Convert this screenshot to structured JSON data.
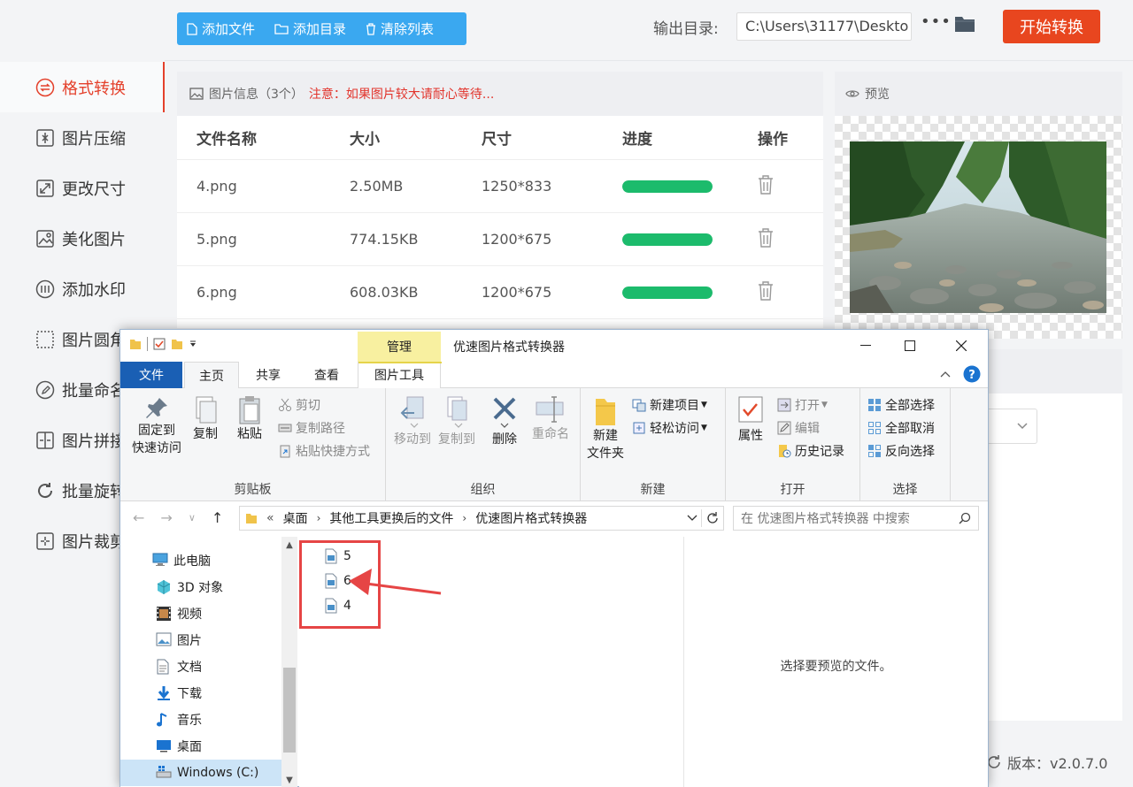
{
  "sidebar": {
    "items": [
      {
        "label": "格式转换",
        "icon": "format-convert-icon"
      },
      {
        "label": "图片压缩",
        "icon": "compress-icon"
      },
      {
        "label": "更改尺寸",
        "icon": "resize-icon"
      },
      {
        "label": "美化图片",
        "icon": "beautify-icon"
      },
      {
        "label": "添加水印",
        "icon": "watermark-icon"
      },
      {
        "label": "图片圆角",
        "icon": "round-corner-icon"
      },
      {
        "label": "批量命名",
        "icon": "rename-icon"
      },
      {
        "label": "图片拼接",
        "icon": "stitch-icon"
      },
      {
        "label": "批量旋转",
        "icon": "rotate-icon"
      },
      {
        "label": "图片裁剪",
        "icon": "crop-icon"
      }
    ]
  },
  "toolbar": {
    "add_file": "添加文件",
    "add_dir": "添加目录",
    "clear_list": "清除列表",
    "output_label": "输出目录:",
    "output_path": "C:\\Users\\31177\\Deskto",
    "more": "•••",
    "start": "开始转换"
  },
  "file_panel": {
    "info": "图片信息（3个）",
    "warning": "注意：如果图片较大请耐心等待...",
    "columns": [
      "文件名称",
      "大小",
      "尺寸",
      "进度",
      "操作"
    ],
    "rows": [
      {
        "name": "4.png",
        "size": "2.50MB",
        "dims": "1250*833",
        "progress": 1.0
      },
      {
        "name": "5.png",
        "size": "774.15KB",
        "dims": "1200*675",
        "progress": 1.0
      },
      {
        "name": "6.png",
        "size": "608.03KB",
        "dims": "1200*675",
        "progress": 1.0
      }
    ]
  },
  "preview": {
    "title": "预览"
  },
  "version": "版本：v2.0.7.0",
  "colors": {
    "accent": "#e4402b",
    "blue": "#3aa8f0",
    "progress": "#1cbb6c",
    "start": "#e8461f"
  },
  "explorer": {
    "manage_tab": "管理",
    "title": "优速图片格式转换器",
    "tabs": {
      "file": "文件",
      "home": "主页",
      "share": "共享",
      "view": "查看",
      "tools": "图片工具"
    },
    "ribbon": {
      "pin": "固定到\n快速访问",
      "copy": "复制",
      "paste": "粘贴",
      "cut": "剪切",
      "copy_path": "复制路径",
      "paste_shortcut": "粘贴快捷方式",
      "clipboard": "剪贴板",
      "move_to": "移动到",
      "copy_to": "复制到",
      "delete": "删除",
      "rename": "重命名",
      "organize": "组织",
      "new_folder": "新建\n文件夹",
      "new_item": "新建项目",
      "easy_access": "轻松访问",
      "new": "新建",
      "properties": "属性",
      "open": "打开",
      "edit": "编辑",
      "history": "历史记录",
      "open_group": "打开",
      "select_all": "全部选择",
      "select_none": "全部取消",
      "invert": "反向选择",
      "select_group": "选择"
    },
    "breadcrumb": [
      "«",
      "桌面",
      "其他工具更换后的文件",
      "优速图片格式转换器"
    ],
    "search_placeholder": "在 优速图片格式转换器 中搜索",
    "nav": [
      {
        "label": "此电脑",
        "icon": "pc-icon"
      },
      {
        "label": "3D 对象",
        "icon": "3d-objects-icon"
      },
      {
        "label": "视频",
        "icon": "video-icon"
      },
      {
        "label": "图片",
        "icon": "pictures-icon"
      },
      {
        "label": "文档",
        "icon": "documents-icon"
      },
      {
        "label": "下载",
        "icon": "downloads-icon"
      },
      {
        "label": "音乐",
        "icon": "music-icon"
      },
      {
        "label": "桌面",
        "icon": "desktop-icon"
      },
      {
        "label": "Windows (C:)",
        "icon": "drive-icon"
      }
    ],
    "files": [
      "5",
      "6",
      "4"
    ],
    "preview_msg": "选择要预览的文件。"
  }
}
